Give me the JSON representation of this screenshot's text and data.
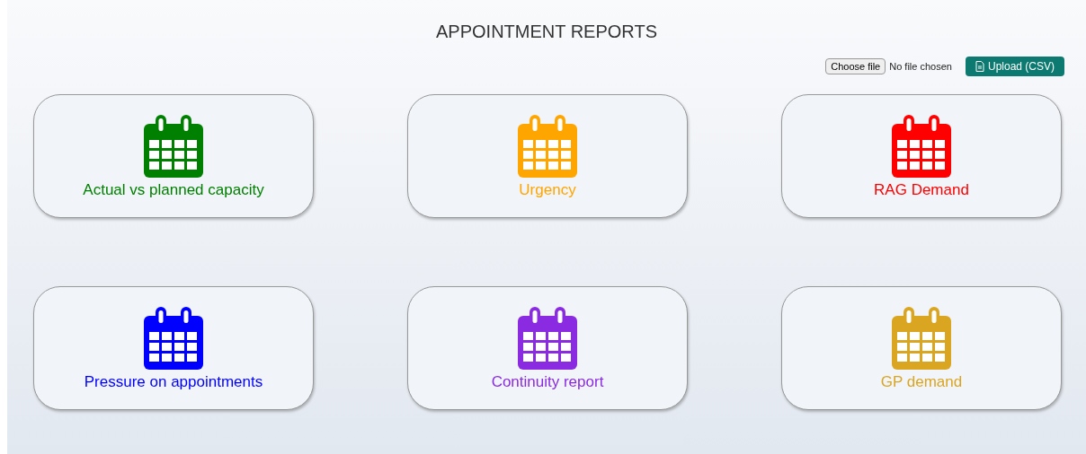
{
  "title": "APPOINTMENT REPORTS",
  "upload": {
    "choose_button": "Choose file",
    "file_status": "No file chosen",
    "upload_button": "Upload (CSV)"
  },
  "reports": [
    {
      "label": "Actual vs planned capacity",
      "color": "#008000"
    },
    {
      "label": "Urgency",
      "color": "#ffa500"
    },
    {
      "label": "RAG Demand",
      "color": "#ff0000"
    },
    {
      "label": "Pressure on appointments",
      "color": "#0000ff"
    },
    {
      "label": "Continuity report",
      "color": "#8a2be2"
    },
    {
      "label": "GP demand",
      "color": "#daa520"
    }
  ]
}
